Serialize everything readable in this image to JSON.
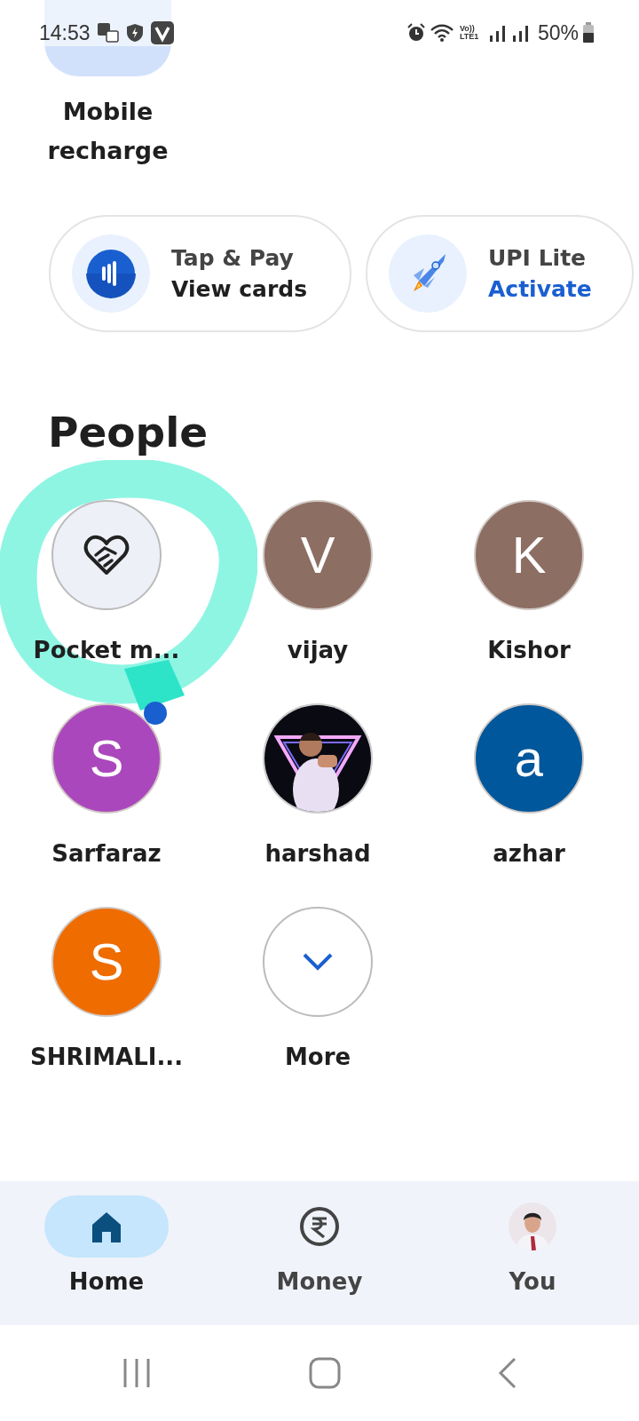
{
  "status_bar": {
    "time": "14:53",
    "network": "Vo)) LTE1",
    "battery": "50%"
  },
  "top_tile": {
    "label": "Mobile recharge"
  },
  "quick_actions": [
    {
      "kind": "tap",
      "title": "Tap & Pay",
      "action": "View cards",
      "highlight": false
    },
    {
      "kind": "rocket",
      "title": "UPI Lite",
      "action": "Activate",
      "highlight": true
    }
  ],
  "people": {
    "title": "People",
    "items": [
      {
        "kind": "icon",
        "name": "Pocket m...",
        "dot": false
      },
      {
        "kind": "letter",
        "initial": "V",
        "name": "vijay",
        "color": "#8d6e63",
        "dot": false
      },
      {
        "kind": "letter",
        "initial": "K",
        "name": "Kishor",
        "color": "#8d6e63",
        "dot": false
      },
      {
        "kind": "letter",
        "initial": "S",
        "name": "Sarfaraz",
        "color": "#ab47bc",
        "dot": true
      },
      {
        "kind": "picture",
        "name": "harshad",
        "dot": false
      },
      {
        "kind": "letter",
        "initial": "a",
        "name": "azhar",
        "color": "#01579b",
        "dot": false
      },
      {
        "kind": "letter",
        "initial": "S",
        "name": "SHRIMALI...",
        "color": "#ef6c00",
        "dot": false
      },
      {
        "kind": "more",
        "name": "More",
        "dot": false
      }
    ]
  },
  "bottom_nav": [
    {
      "kind": "home",
      "label": "Home",
      "selected": true
    },
    {
      "kind": "money",
      "label": "Money",
      "selected": false
    },
    {
      "kind": "you",
      "label": "You",
      "selected": false
    }
  ]
}
